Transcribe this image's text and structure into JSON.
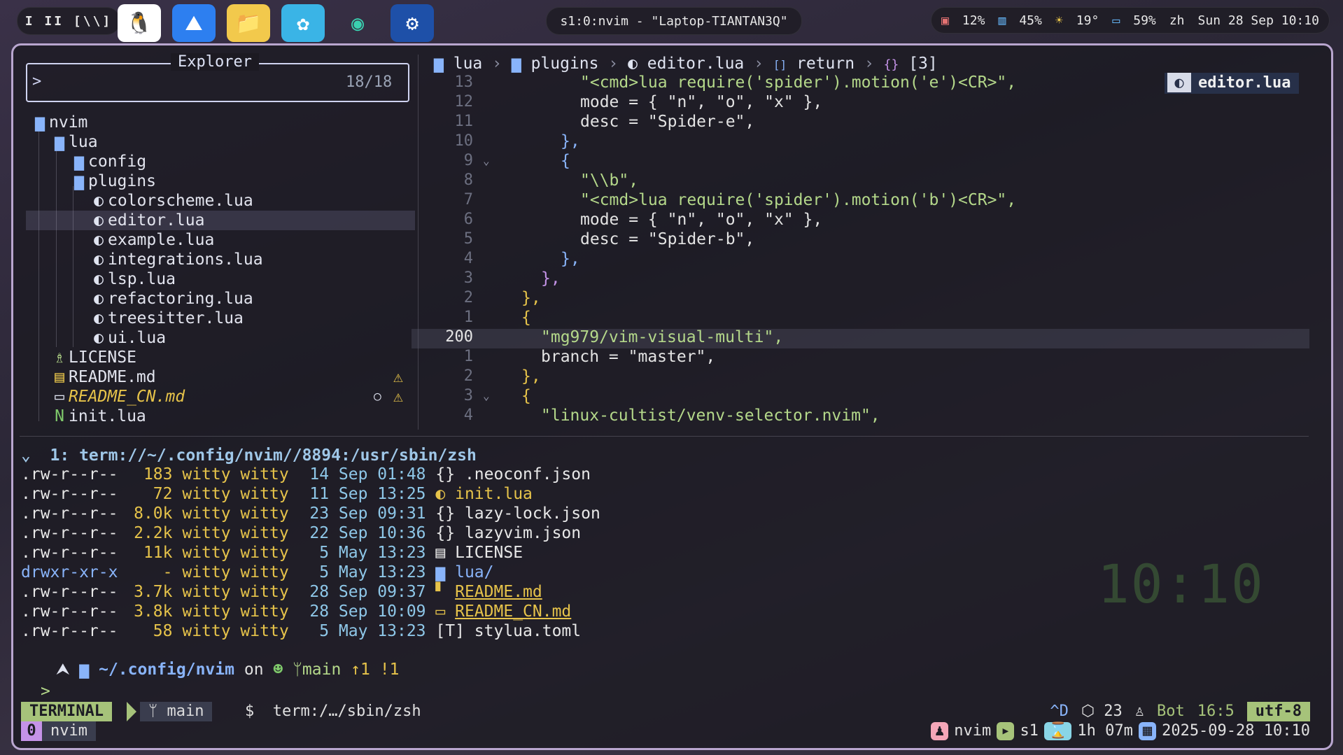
{
  "topbar": {
    "workspaces": "I II [\\\\]",
    "window_title": "s1:0:nvim - \"Laptop-TIANTAN3Q\"",
    "cpu": "12%",
    "mem": "45%",
    "temp": "19°",
    "battery": "59%",
    "lang": "zh",
    "datetime": "Sun 28 Sep 10:10"
  },
  "explorer": {
    "title": "Explorer",
    "prompt": ">",
    "count": "18/18",
    "items": [
      {
        "label": "nvim",
        "icon": "folder-open-icon"
      },
      {
        "label": "lua",
        "icon": "folder-open-icon"
      },
      {
        "label": "config",
        "icon": "folder-icon"
      },
      {
        "label": "plugins",
        "icon": "folder-open-icon"
      },
      {
        "label": "colorscheme.lua",
        "icon": "lua-icon"
      },
      {
        "label": "editor.lua",
        "icon": "lua-icon"
      },
      {
        "label": "example.lua",
        "icon": "lua-icon"
      },
      {
        "label": "integrations.lua",
        "icon": "lua-icon"
      },
      {
        "label": "lsp.lua",
        "icon": "lua-icon"
      },
      {
        "label": "refactoring.lua",
        "icon": "lua-icon"
      },
      {
        "label": "treesitter.lua",
        "icon": "lua-icon"
      },
      {
        "label": "ui.lua",
        "icon": "lua-icon"
      },
      {
        "label": "LICENSE",
        "icon": "license-icon"
      },
      {
        "label": "README.md",
        "icon": "markdown-icon"
      },
      {
        "label": "README_CN.md",
        "icon": "markdown-icon"
      },
      {
        "label": "init.lua",
        "icon": "neovim-icon"
      }
    ]
  },
  "editor": {
    "breadcrumb": [
      "lua",
      "plugins",
      "editor.lua",
      "return",
      "[3]"
    ],
    "file_tag": "editor.lua",
    "line_numbers": [
      "13",
      "12",
      "11",
      "10",
      "9",
      "8",
      "7",
      "6",
      "5",
      "4",
      "3",
      "2",
      "1",
      "200",
      "1",
      "2",
      "3",
      "4"
    ],
    "current_line": "200",
    "lines": [
      "\"<cmd>lua require('spider').motion('e')<CR>\",",
      "mode = { \"n\", \"o\", \"x\" },",
      "desc = \"Spider-e\",",
      "},",
      "{",
      "\"\\\\b\",",
      "\"<cmd>lua require('spider').motion('b')<CR>\",",
      "mode = { \"n\", \"o\", \"x\" },",
      "desc = \"Spider-b\",",
      "},",
      "},",
      "},",
      "{",
      "\"mg979/vim-visual-multi\",",
      "branch = \"master\",",
      "},",
      "{",
      "\"linux-cultist/venv-selector.nvim\","
    ]
  },
  "terminal": {
    "header": "1: term://~/.config/nvim//8894:/usr/sbin/zsh",
    "rows": [
      {
        "perm": ".rw-r--r--",
        "size": "183",
        "user": "witty witty",
        "date": "14 Sep 01:48",
        "icon": "{}",
        "name": ".neoconf.json"
      },
      {
        "perm": ".rw-r--r--",
        "size": "72",
        "user": "witty witty",
        "date": "11 Sep 13:25",
        "icon": "◐",
        "name": "init.lua"
      },
      {
        "perm": ".rw-r--r--",
        "size": "8.0k",
        "user": "witty witty",
        "date": "23 Sep 09:31",
        "icon": "{}",
        "name": "lazy-lock.json"
      },
      {
        "perm": ".rw-r--r--",
        "size": "2.2k",
        "user": "witty witty",
        "date": "22 Sep 10:36",
        "icon": "{}",
        "name": "lazyvim.json"
      },
      {
        "perm": ".rw-r--r--",
        "size": "11k",
        "user": "witty witty",
        "date": "5 May 13:23",
        "icon": "▤",
        "name": "LICENSE"
      },
      {
        "perm": "drwxr-xr-x",
        "size": "-",
        "user": "witty witty",
        "date": "5 May 13:23",
        "icon": "▆",
        "name": "lua/"
      },
      {
        "perm": ".rw-r--r--",
        "size": "3.7k",
        "user": "witty witty",
        "date": "28 Sep 09:37",
        "icon": "▘",
        "name": "README.md"
      },
      {
        "perm": ".rw-r--r--",
        "size": "3.8k",
        "user": "witty witty",
        "date": "28 Sep 10:09",
        "icon": "▭",
        "name": "README_CN.md"
      },
      {
        "perm": ".rw-r--r--",
        "size": "58",
        "user": "witty witty",
        "date": "5 May 13:23",
        "icon": "[T]",
        "name": "stylua.toml"
      }
    ],
    "prompt_path": "~/.config/nvim",
    "prompt_on": "on",
    "prompt_branch": "main",
    "prompt_ahead": "↑1",
    "prompt_mod": "!1",
    "caret": ">",
    "big_clock": "10:10"
  },
  "statusline": {
    "mode": "TERMINAL",
    "branch": "main",
    "file": "$  term:/…/sbin/zsh",
    "ctrl": "^D",
    "count": "23",
    "pos_word": "Bot",
    "pos": "16:5",
    "enc": "utf-8"
  },
  "tmux": {
    "index": "0",
    "window": "nvim",
    "app": "nvim",
    "session": "s1",
    "uptime": "1h 07m",
    "date": "2025-09-28 10:10"
  },
  "colors": {
    "accent": "#a6c37a",
    "frame": "#b9a6cf",
    "string": "#b4d88a",
    "highlight": "#e6c34a"
  }
}
